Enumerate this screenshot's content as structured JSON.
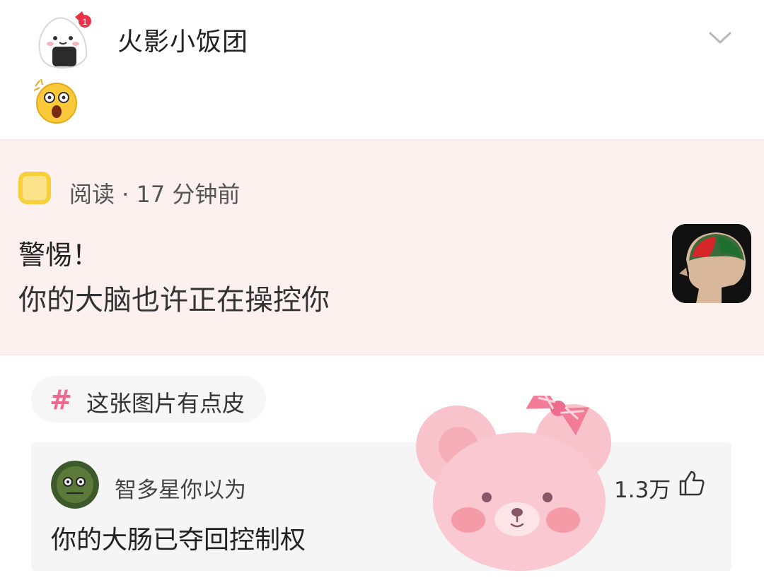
{
  "header": {
    "username": "火影小饭团",
    "avatar_icon": "rice-ball-avatar-icon",
    "badge_text": "1",
    "expand_icon": "chevron-down-icon",
    "emoji_icon": "shocked-face-emoji-icon"
  },
  "reading_card": {
    "icon": "reading-book-icon",
    "meta": "阅读 · 17 分钟前",
    "title_line1": "警惕！",
    "title_line2": "你的大脑也许正在操控你",
    "thumbnail_icon": "brain-head-thumbnail",
    "background_color": "#fdf1f0"
  },
  "topic": {
    "hash": "#",
    "label": "这张图片有点皮",
    "hash_color": "#ef6a8e"
  },
  "comment": {
    "avatar_icon": "green-face-avatar-icon",
    "username": "智多星你以为",
    "likes": "1.3万",
    "like_icon": "thumbs-up-icon",
    "text": "你的大肠已夺回控制权"
  },
  "sticker": {
    "icon": "pink-bear-sticker"
  }
}
